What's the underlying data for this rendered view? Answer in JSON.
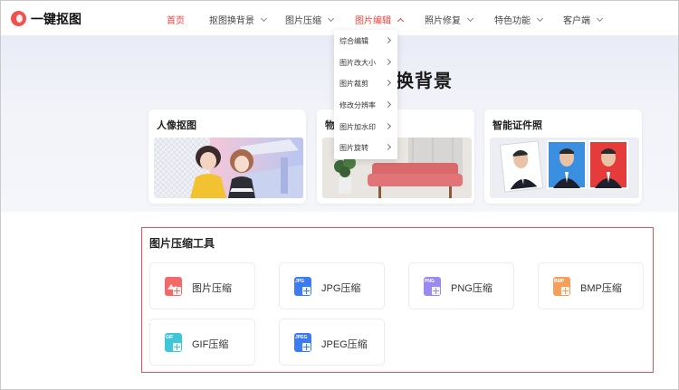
{
  "brand": {
    "name": "一键抠图"
  },
  "nav": {
    "items": [
      {
        "label": "首页",
        "active": true,
        "has_menu": false
      },
      {
        "label": "抠图换背景",
        "active": false,
        "has_menu": true
      },
      {
        "label": "图片压缩",
        "active": false,
        "has_menu": true
      },
      {
        "label": "图片编辑",
        "active": true,
        "has_menu": true,
        "open": true
      },
      {
        "label": "照片修复",
        "active": false,
        "has_menu": true
      },
      {
        "label": "特色功能",
        "active": false,
        "has_menu": true
      },
      {
        "label": "客户端",
        "active": false,
        "has_menu": true
      }
    ]
  },
  "dropdown": {
    "items": [
      {
        "label": "综合编辑"
      },
      {
        "label": "图片改大小"
      },
      {
        "label": "图片裁剪"
      },
      {
        "label": "修改分辨率"
      },
      {
        "label": "图片加水印"
      },
      {
        "label": "图片旋转"
      }
    ]
  },
  "hero": {
    "title": "换背景",
    "cards": [
      {
        "title": "人像抠图"
      },
      {
        "title": "物"
      },
      {
        "title": "智能证件照"
      }
    ]
  },
  "tools": {
    "title": "图片压缩工具",
    "items": [
      {
        "label": "图片压缩",
        "icon": "image-compress-icon",
        "badge": "",
        "color": "#f06a6a"
      },
      {
        "label": "JPG压缩",
        "icon": "jpg-file-icon",
        "badge": "JPG",
        "color": "#3d7cf0"
      },
      {
        "label": "PNG压缩",
        "icon": "png-file-icon",
        "badge": "PNG",
        "color": "#9b88f0"
      },
      {
        "label": "BMP压缩",
        "icon": "bmp-file-icon",
        "badge": "BMP",
        "color": "#f5a05a"
      },
      {
        "label": "GIF压缩",
        "icon": "gif-file-icon",
        "badge": "GIF",
        "color": "#3fc6d8"
      },
      {
        "label": "JPEG压缩",
        "icon": "jpeg-file-icon",
        "badge": "JPEG",
        "color": "#3d7cf0"
      }
    ]
  },
  "colors": {
    "accent": "#e8433f",
    "highlight_box": "#e25555"
  }
}
